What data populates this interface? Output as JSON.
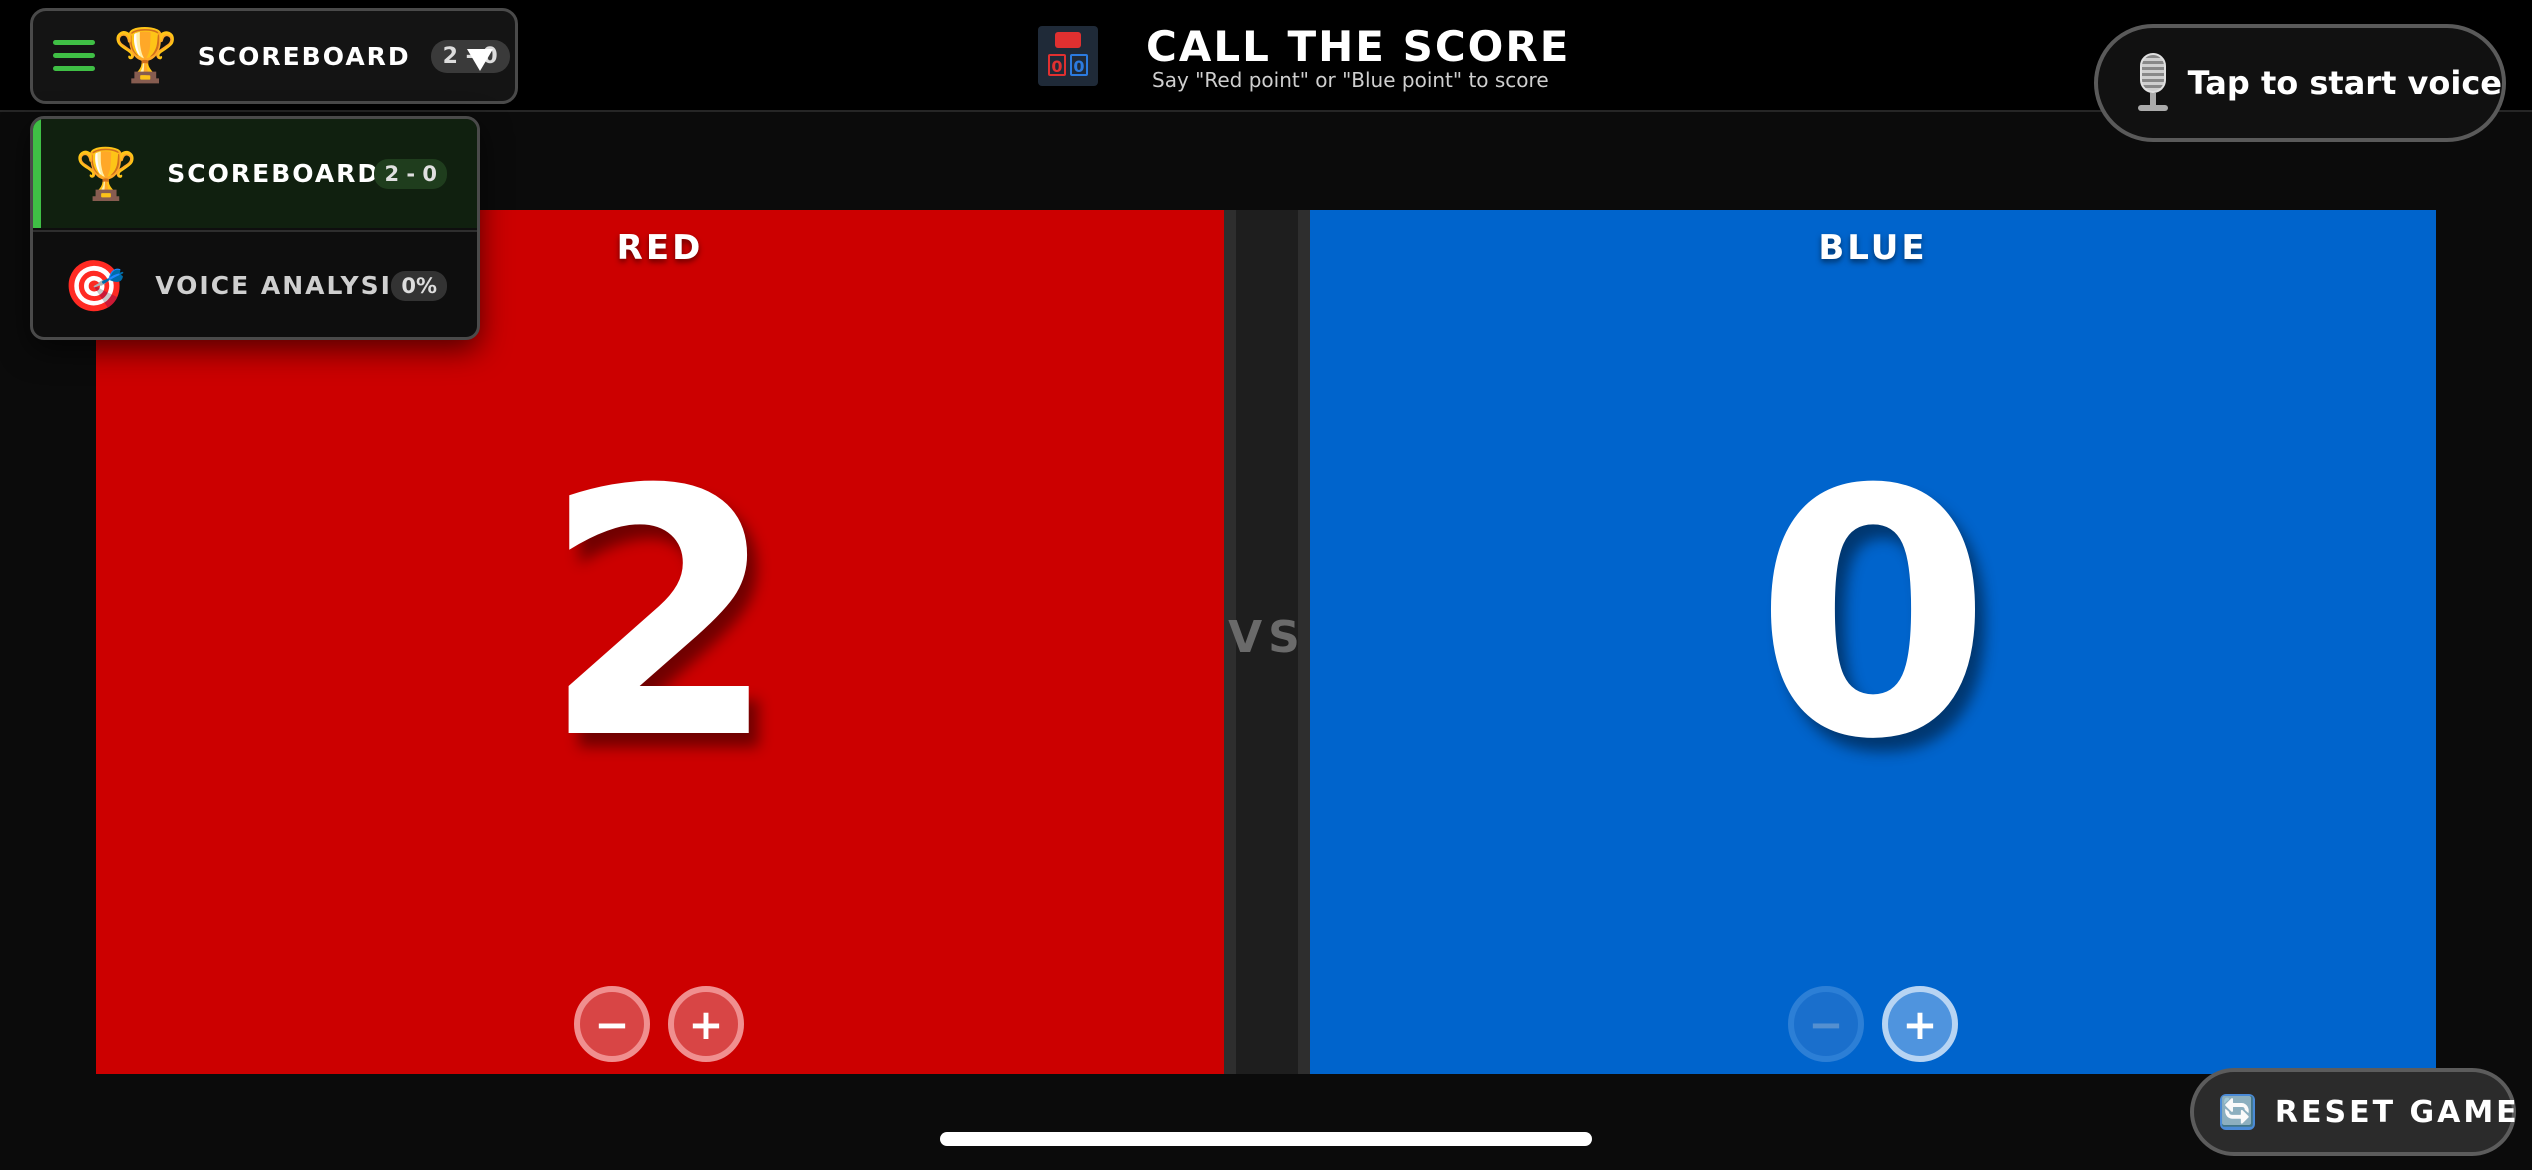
{
  "header": {
    "menu": {
      "label": "SCOREBOARD",
      "badge": "2 - 0",
      "icon": "trophy-icon"
    },
    "title": "CALL THE SCORE",
    "subtitle": "Say \"Red point\" or \"Blue point\" to score",
    "app_icon": {
      "top": "📢",
      "digit_left": "0",
      "digit_right": "0"
    },
    "voice_button": {
      "label": "Tap to start voice",
      "icon": "microphone-icon"
    }
  },
  "dropdown": {
    "items": [
      {
        "label": "SCOREBOARD",
        "badge": "2 - 0",
        "icon": "🏆",
        "active": true
      },
      {
        "label": "VOICE ANALYSIS",
        "badge": "0%",
        "icon": "🎯",
        "active": false
      }
    ]
  },
  "teams": {
    "red": {
      "name": "RED",
      "score": "2",
      "color": "#cc0000"
    },
    "blue": {
      "name": "BLUE",
      "score": "0",
      "color": "#0064cc"
    }
  },
  "vs_label": "VS",
  "controls": {
    "minus": "−",
    "plus": "+"
  },
  "reset": {
    "label": "RESET GAME",
    "icon": "🔄"
  },
  "colors": {
    "accent_green": "#3fbf45",
    "background": "#0b0b0b"
  }
}
